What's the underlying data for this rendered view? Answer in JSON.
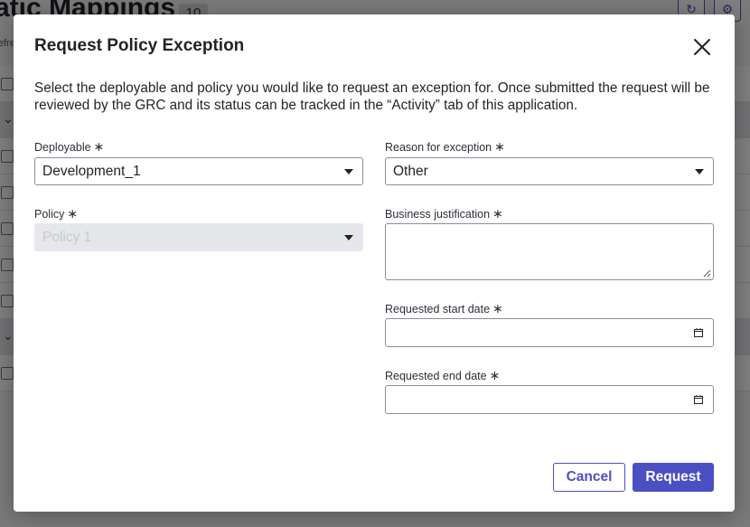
{
  "background": {
    "title": "atic Mappings",
    "count": "10",
    "subtext": "efre"
  },
  "modal": {
    "title": "Request Policy Exception",
    "intro": "Select the deployable and policy you would like to request an exception for.   Once submitted the request will be reviewed by the GRC and its status can be tracked in the “Activity” tab of this application.",
    "required_marker": "∗",
    "deployable": {
      "label": "Deployable",
      "value": "Development_1"
    },
    "policy": {
      "label": "Policy",
      "value": "Policy 1",
      "disabled": true
    },
    "reason": {
      "label": "Reason for exception",
      "value": "Other"
    },
    "justification": {
      "label": "Business justification",
      "value": ""
    },
    "start_date": {
      "label": "Requested start date",
      "value": ""
    },
    "end_date": {
      "label": "Requested end date",
      "value": ""
    },
    "cancel_label": "Cancel",
    "request_label": "Request"
  },
  "colors": {
    "accent": "#4b4fc4",
    "overlay": "rgba(0,0,0,0.5)"
  }
}
